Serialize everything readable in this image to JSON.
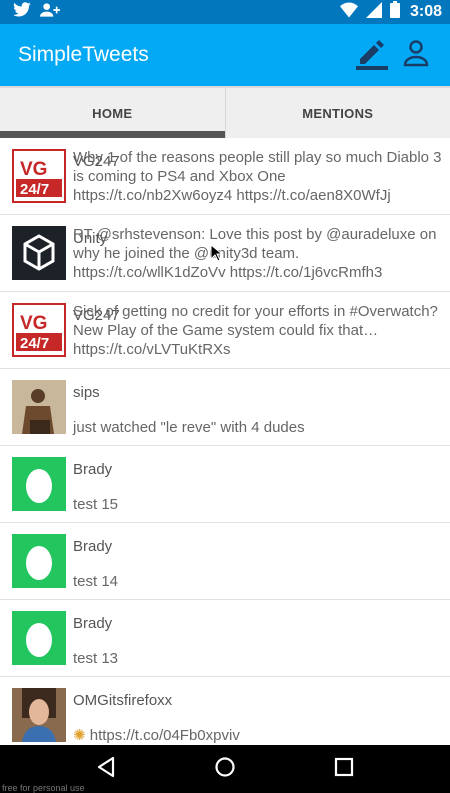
{
  "status_bar": {
    "time": "3:08",
    "icons": [
      "twitter-icon",
      "add-person-icon",
      "wifi-icon",
      "signal-icon",
      "battery-icon"
    ]
  },
  "app_bar": {
    "title": "SimpleTweets",
    "actions": [
      "compose-icon",
      "profile-icon"
    ]
  },
  "tabs": [
    {
      "label": "HOME",
      "selected": true
    },
    {
      "label": "MENTIONS",
      "selected": false
    }
  ],
  "tweets": [
    {
      "avatar": "vg247",
      "username": "VG247",
      "body": "Why 1 of the reasons people still play so much Diablo 3 is coming to PS4 and Xbox One https://t.co/nb2Xw6oyz4 https://t.co/aen8X0WfJj"
    },
    {
      "avatar": "unity",
      "username": "Unity",
      "body": "RT @srhstevenson: Love this post by @auradeluxe on why he joined the @unity3d team. https://t.co/wllK1dZoVv https://t.co/1j6vcRmfh3"
    },
    {
      "avatar": "vg247",
      "username": "VG247",
      "body": "Sick of getting no credit for your efforts in #Overwatch? New Play of the Game system could fix that… https://t.co/vLVTuKtRXs"
    },
    {
      "avatar": "sips",
      "username": "sips",
      "body": "just watched \"le reve\" with 4 dudes"
    },
    {
      "avatar": "egg",
      "username": "Brady",
      "body": "test 15"
    },
    {
      "avatar": "egg",
      "username": "Brady",
      "body": "test 14"
    },
    {
      "avatar": "egg",
      "username": "Brady",
      "body": "test 13"
    },
    {
      "avatar": "omg",
      "username": "OMGitsfirefoxx",
      "body": "https://t.co/04Fb0xpviv"
    }
  ],
  "nav_bar": [
    "back-icon",
    "home-icon",
    "recents-icon"
  ],
  "watermark": "free for personal use",
  "colors": {
    "status_bar": "#0277bd",
    "app_bar": "#03a9f4",
    "egg_avatar": "#22c55e"
  }
}
